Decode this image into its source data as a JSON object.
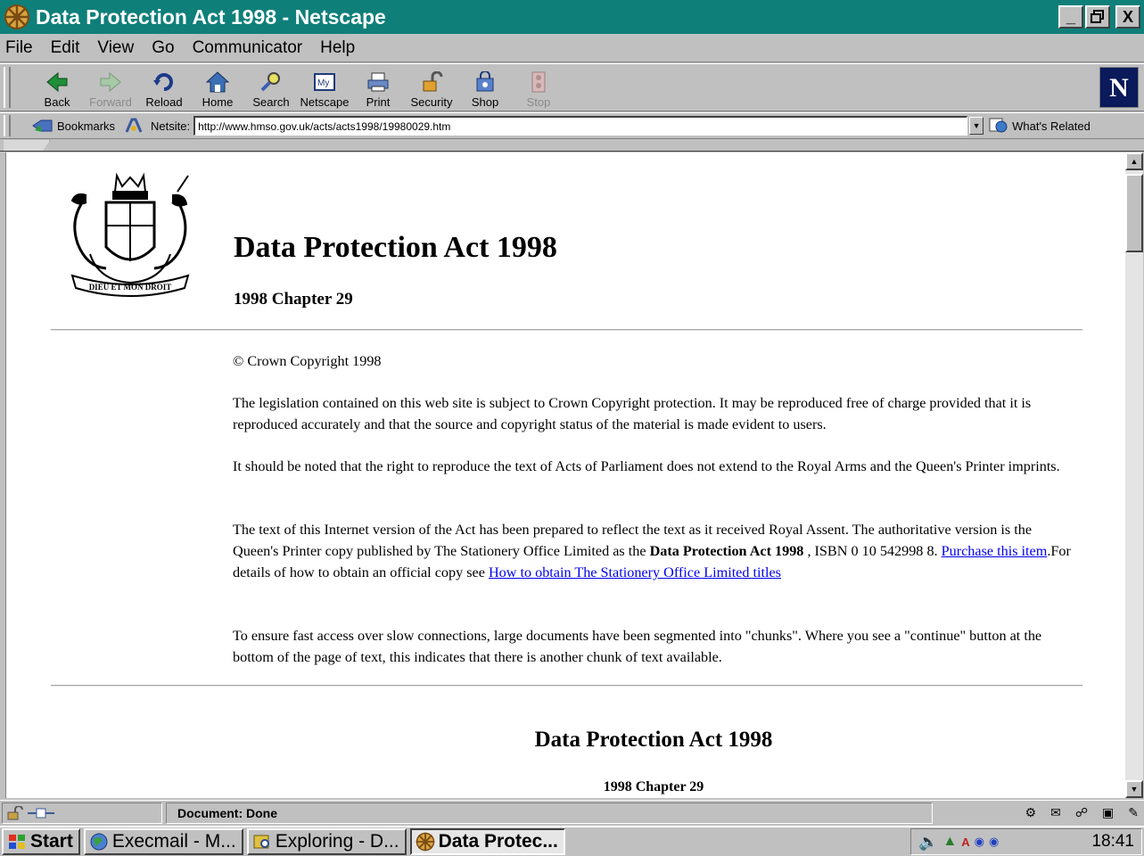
{
  "window": {
    "title": "Data Protection Act 1998 - Netscape",
    "title_bar_color": "#0f7f7a",
    "controls": {
      "minimize": "_",
      "restore": "❐",
      "close": "X"
    }
  },
  "menu": {
    "items": [
      {
        "label": "File"
      },
      {
        "label": "Edit"
      },
      {
        "label": "View"
      },
      {
        "label": "Go"
      },
      {
        "label": "Communicator"
      },
      {
        "label": "Help"
      }
    ]
  },
  "toolbar": {
    "buttons": [
      {
        "label": "Back",
        "icon": "back-arrow-icon"
      },
      {
        "label": "Forward",
        "icon": "forward-arrow-icon"
      },
      {
        "label": "Reload",
        "icon": "reload-icon"
      },
      {
        "label": "Home",
        "icon": "home-icon"
      },
      {
        "label": "Search",
        "icon": "search-icon"
      },
      {
        "label": "Netscape",
        "icon": "my-netscape-icon"
      },
      {
        "label": "Print",
        "icon": "print-icon"
      },
      {
        "label": "Security",
        "icon": "lock-icon"
      },
      {
        "label": "Shop",
        "icon": "shop-icon"
      },
      {
        "label": "Stop",
        "icon": "stop-icon"
      }
    ],
    "logo": "N"
  },
  "location": {
    "bookmarks_label": "Bookmarks",
    "netsite_label": "Netsite:",
    "url": "http://www.hmso.gov.uk/acts/acts1998/19980029.htm",
    "related_label": "What's Related"
  },
  "page": {
    "heading": "Data Protection Act 1998",
    "subheading": "1998 Chapter 29",
    "copyright": "© Crown Copyright 1998",
    "para1": "The legislation contained on this web site is subject to Crown Copyright protection. It may be reproduced free of charge provided that it is reproduced accurately and that the source and copyright status of the material is made evident to users.",
    "para2": "It should be noted that the right to reproduce the text of Acts of Parliament does not extend to the Royal Arms and the Queen's Printer imprints.",
    "para3_a": "The text of this Internet version of the Act has been prepared to reflect the text as it received Royal Assent. The authoritative version is the Queen's Printer copy published by The Stationery Office Limited as the ",
    "para3_bold": "Data Protection Act 1998",
    "para3_b": " , ISBN 0 10 542998 8. ",
    "purchase_link": "Purchase this item",
    "para3_c": ".For details of how to obtain an official copy see ",
    "obtain_link": "How to obtain The Stationery Office Limited titles",
    "para4": "To ensure fast access over slow connections, large documents have been segmented into \"chunks\". Where you see a \"continue\" button at the bottom of the page of text, this indicates that there is another chunk of text available.",
    "heading2": "Data Protection Act 1998",
    "subheading2": "1998 Chapter 29",
    "link_color": "#0000ee",
    "crest_motto": "DIEU ET MON DROIT"
  },
  "status": {
    "text": "Document: Done"
  },
  "taskbar": {
    "start_label": "Start",
    "tasks": [
      {
        "label": "Execmail - M...",
        "icon": "globe-icon"
      },
      {
        "label": "Exploring - D...",
        "icon": "explorer-icon"
      },
      {
        "label": "Data Protec...",
        "icon": "netscape-wheel-icon"
      }
    ],
    "clock": "18:41"
  }
}
